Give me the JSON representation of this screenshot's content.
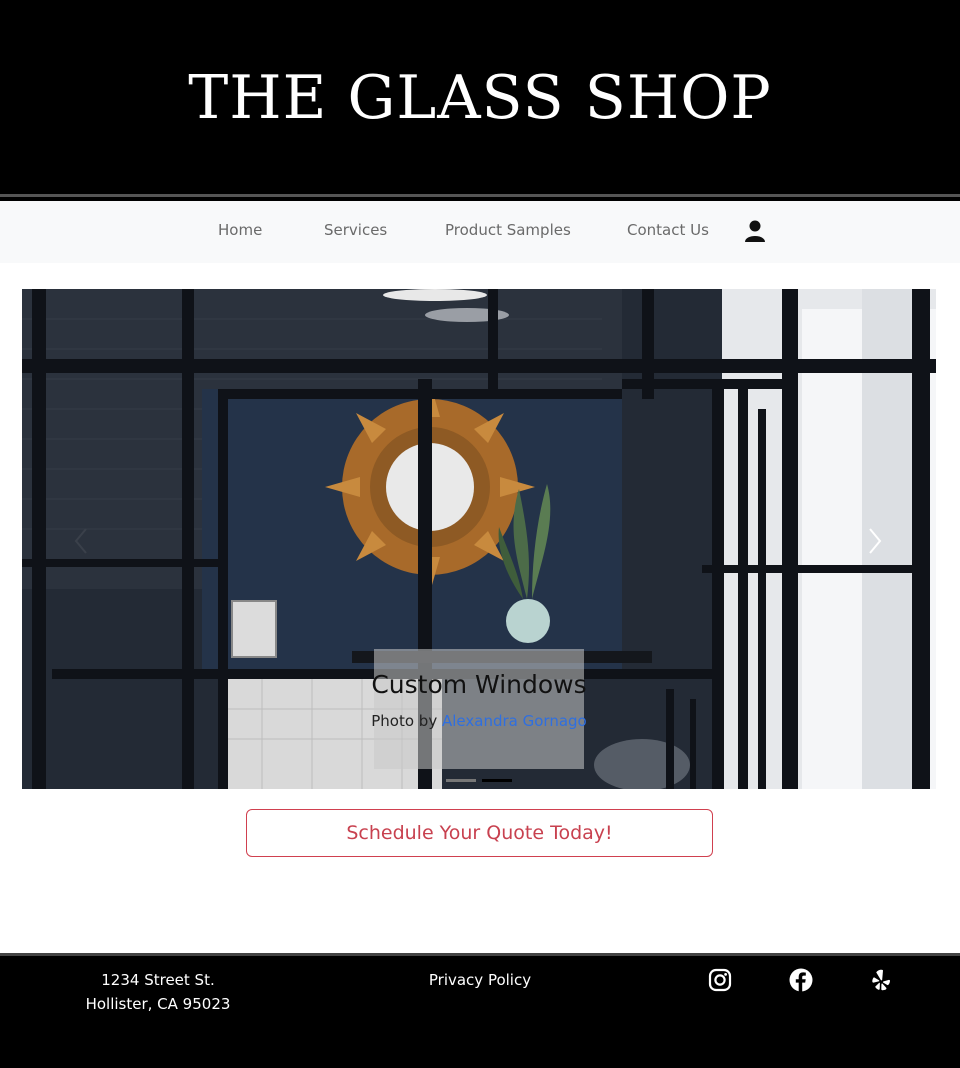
{
  "header": {
    "title": "THE GLASS SHOP"
  },
  "nav": {
    "items": [
      {
        "label": "Home"
      },
      {
        "label": "Services"
      },
      {
        "label": "Product Samples"
      },
      {
        "label": "Contact Us"
      }
    ],
    "user_icon": "user-icon"
  },
  "carousel": {
    "slide_title": "Custom Windows",
    "credit_prefix": "Photo by",
    "credit_name": "Alexandra Gornago",
    "link_color": "#2f6fe0",
    "slide_count": 2,
    "active_slide": 2,
    "prev_icon": "chevron-left-icon",
    "next_icon": "chevron-right-icon"
  },
  "cta": {
    "label": "Schedule Your Quote Today!",
    "color": "#c8414f"
  },
  "footer": {
    "address_line1": "1234 Street St.",
    "address_line2": "Hollister, CA 95023",
    "privacy": "Privacy Policy",
    "social_icons": [
      "instagram-icon",
      "facebook-icon",
      "yelp-icon"
    ]
  }
}
